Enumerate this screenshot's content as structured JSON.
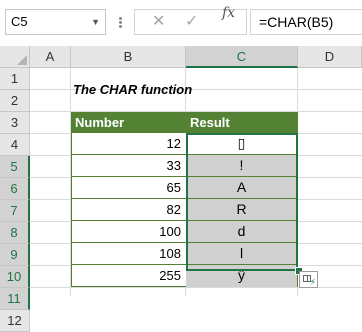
{
  "formula_bar": {
    "name_box": "C5",
    "cancel_symbol": "✕",
    "enter_symbol": "✓",
    "fx_label": "fx",
    "formula": "=CHAR(B5)"
  },
  "columns": [
    "A",
    "B",
    "C",
    "D"
  ],
  "selected_column": "C",
  "rows": [
    "1",
    "2",
    "3",
    "4",
    "5",
    "6",
    "7",
    "8",
    "9",
    "10",
    "11",
    "12"
  ],
  "selected_rows": [
    "5",
    "6",
    "7",
    "8",
    "9",
    "10",
    "11"
  ],
  "sheet": {
    "title": "The CHAR function",
    "headers": {
      "number": "Number",
      "result": "Result"
    },
    "table": [
      {
        "number": "12",
        "result": "▯"
      },
      {
        "number": "33",
        "result": "!"
      },
      {
        "number": "65",
        "result": "A"
      },
      {
        "number": "82",
        "result": "R"
      },
      {
        "number": "100",
        "result": "d"
      },
      {
        "number": "108",
        "result": "l"
      },
      {
        "number": "255",
        "result": "ÿ"
      }
    ]
  },
  "colors": {
    "header_fill": "#548235",
    "selection_border": "#217346",
    "selected_fill": "#d0d0d0"
  }
}
